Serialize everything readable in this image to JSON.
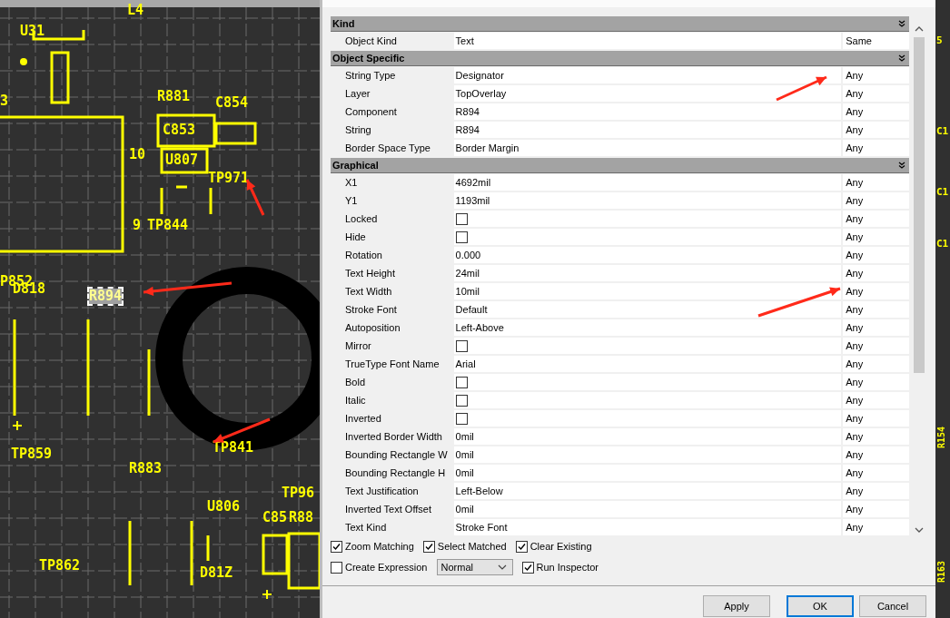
{
  "canvas": {
    "labels": [
      {
        "text": "L4",
        "selected": false
      },
      {
        "text": "U31",
        "selected": false
      },
      {
        "text": "3",
        "selected": false
      },
      {
        "text": "R881",
        "selected": false
      },
      {
        "text": "C854",
        "selected": false
      },
      {
        "text": "C853",
        "selected": false
      },
      {
        "text": "10",
        "selected": false
      },
      {
        "text": "U807",
        "selected": false
      },
      {
        "text": "TP971",
        "selected": false
      },
      {
        "text": "9",
        "selected": false
      },
      {
        "text": "TP844",
        "selected": false
      },
      {
        "text": "P852",
        "selected": false
      },
      {
        "text": "D818",
        "selected": false
      },
      {
        "text": "R894",
        "selected": true
      },
      {
        "text": "TP841",
        "selected": false
      },
      {
        "text": "TP859",
        "selected": false
      },
      {
        "text": "R883",
        "selected": false
      },
      {
        "text": "TP96",
        "selected": false
      },
      {
        "text": "U806",
        "selected": false
      },
      {
        "text": "C85",
        "selected": false
      },
      {
        "text": "R88",
        "selected": false
      },
      {
        "text": "TP862",
        "selected": false
      },
      {
        "text": "D81Z",
        "selected": false
      }
    ]
  },
  "edge_labels": [
    "5",
    "C1",
    "C1",
    "C1",
    "R154",
    "R163"
  ],
  "sections": [
    {
      "title": "Kind",
      "rows": [
        {
          "kind": "text",
          "label": "Object Kind",
          "value": "Text",
          "match": "Same"
        }
      ]
    },
    {
      "title": "Object Specific",
      "rows": [
        {
          "kind": "text",
          "label": "String Type",
          "value": "Designator",
          "match": "Any"
        },
        {
          "kind": "text",
          "label": "Layer",
          "value": "TopOverlay",
          "match": "Any"
        },
        {
          "kind": "text",
          "label": "Component",
          "value": "R894",
          "match": "Any"
        },
        {
          "kind": "text",
          "label": "String",
          "value": "R894",
          "match": "Any"
        },
        {
          "kind": "text",
          "label": "Border Space Type",
          "value": "Border Margin",
          "match": "Any"
        }
      ]
    },
    {
      "title": "Graphical",
      "rows": [
        {
          "kind": "text",
          "label": "X1",
          "value": "4692mil",
          "match": "Any"
        },
        {
          "kind": "text",
          "label": "Y1",
          "value": "1193mil",
          "match": "Any"
        },
        {
          "kind": "checkbox",
          "label": "Locked",
          "checked": false,
          "match": "Any"
        },
        {
          "kind": "checkbox",
          "label": "Hide",
          "checked": false,
          "match": "Any"
        },
        {
          "kind": "text",
          "label": "Rotation",
          "value": "0.000",
          "match": "Any"
        },
        {
          "kind": "text",
          "label": "Text Height",
          "value": "24mil",
          "match": "Any"
        },
        {
          "kind": "text",
          "label": "Text Width",
          "value": "10mil",
          "match": "Any"
        },
        {
          "kind": "text",
          "label": "Stroke Font",
          "value": "Default",
          "match": "Any"
        },
        {
          "kind": "text",
          "label": "Autoposition",
          "value": "Left-Above",
          "match": "Any"
        },
        {
          "kind": "checkbox",
          "label": "Mirror",
          "checked": false,
          "match": "Any"
        },
        {
          "kind": "text",
          "label": "TrueType Font Name",
          "value": "Arial",
          "match": "Any"
        },
        {
          "kind": "checkbox",
          "label": "Bold",
          "checked": false,
          "match": "Any"
        },
        {
          "kind": "checkbox",
          "label": "Italic",
          "checked": false,
          "match": "Any"
        },
        {
          "kind": "checkbox",
          "label": "Inverted",
          "checked": false,
          "match": "Any"
        },
        {
          "kind": "text",
          "label": "Inverted Border Width",
          "value": "0mil",
          "match": "Any"
        },
        {
          "kind": "text",
          "label": "Bounding Rectangle W",
          "value": "0mil",
          "match": "Any"
        },
        {
          "kind": "text",
          "label": "Bounding Rectangle H",
          "value": "0mil",
          "match": "Any"
        },
        {
          "kind": "text",
          "label": "Text Justification",
          "value": "Left-Below",
          "match": "Any"
        },
        {
          "kind": "text",
          "label": "Inverted Text Offset",
          "value": "0mil",
          "match": "Any"
        },
        {
          "kind": "text",
          "label": "Text Kind",
          "value": "Stroke Font",
          "match": "Any"
        }
      ]
    }
  ],
  "options": [
    {
      "label": "Zoom Matching",
      "checked": true
    },
    {
      "label": "Select Matched",
      "checked": true
    },
    {
      "label": "Clear Existing",
      "checked": true
    },
    {
      "label": "Create Expression",
      "checked": false
    },
    {
      "label": "Run Inspector",
      "checked": true
    }
  ],
  "mode_select": {
    "value": "Normal"
  },
  "buttons": [
    {
      "label": "Apply",
      "default": false
    },
    {
      "label": "OK",
      "default": true
    },
    {
      "label": "Cancel",
      "default": false
    }
  ]
}
